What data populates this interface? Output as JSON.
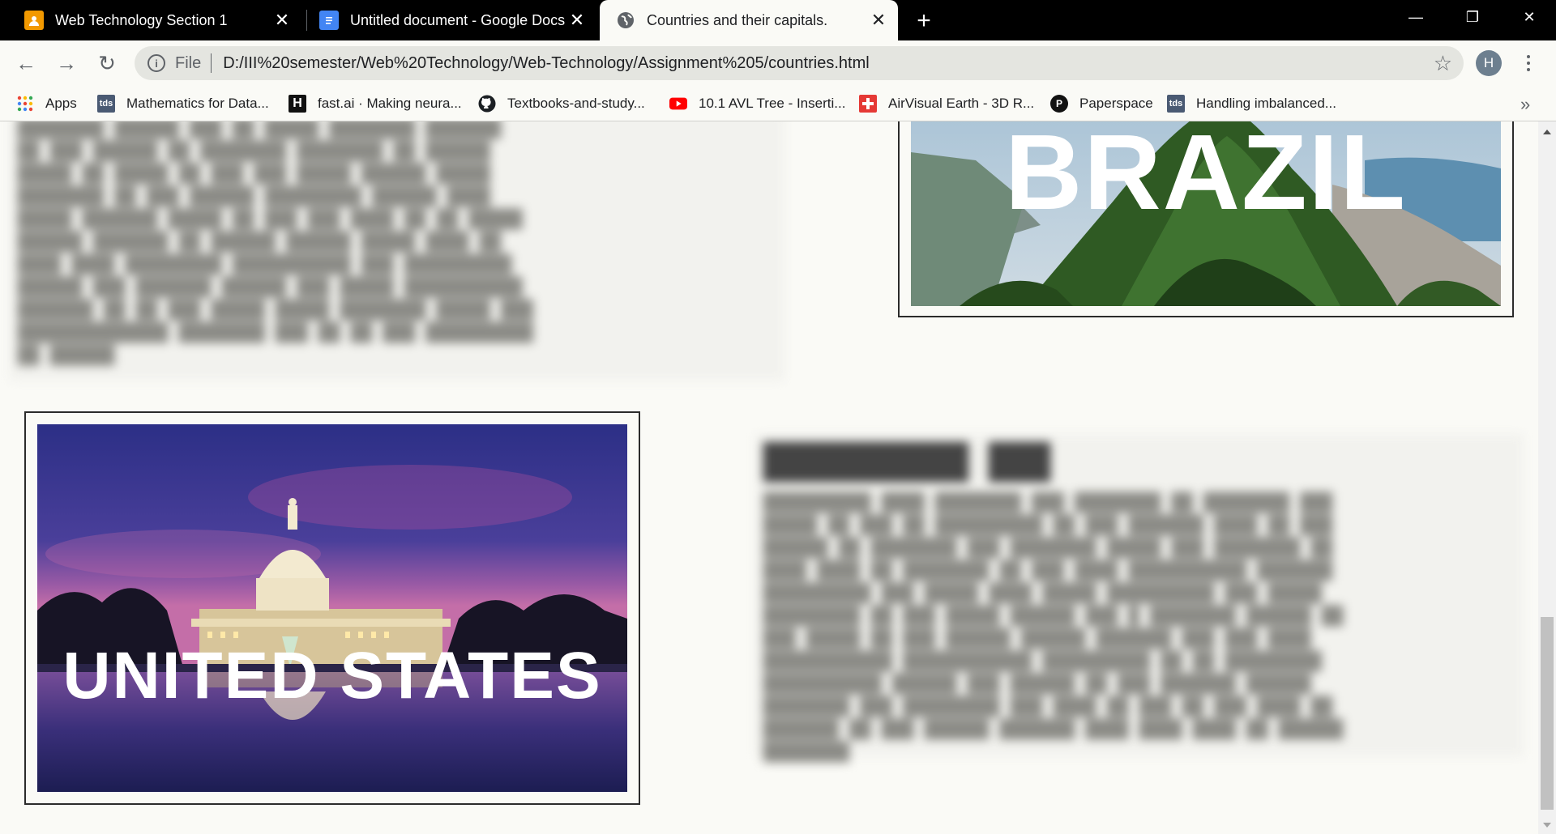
{
  "tabs": [
    {
      "title": "Web Technology Section 1",
      "close": "✕"
    },
    {
      "title": "Untitled document - Google Docs",
      "close": "✕"
    },
    {
      "title": "Countries and their capitals.",
      "close": "✕"
    }
  ],
  "new_tab": "+",
  "window_controls": {
    "minimize": "—",
    "restore": "❐",
    "close": "✕"
  },
  "toolbar": {
    "back": "←",
    "forward": "→",
    "reload": "↻",
    "scheme_label": "File",
    "url": "D:/III%20semester/Web%20Technology/Web-Technology/Assignment%205/countries.html",
    "bookmark_star": "☆",
    "profile_initial": "H"
  },
  "bookmarks": [
    {
      "label": "Apps"
    },
    {
      "label": "Mathematics for Data...",
      "icon_text": "tds"
    },
    {
      "label": "fast.ai · Making neura...",
      "icon_text": "H"
    },
    {
      "label": "Textbooks-and-study..."
    },
    {
      "label": "10.1 AVL Tree - Inserti..."
    },
    {
      "label": "AirVisual Earth - 3D R..."
    },
    {
      "label": "Paperspace",
      "icon_text": "P"
    },
    {
      "label": "Handling imbalanced...",
      "icon_text": "tds"
    }
  ],
  "bookmarks_more": "»",
  "content": {
    "brazil_image_label": "BRAZIL",
    "usa_image_label": "UNITED STATES"
  },
  "colors": {
    "page_background": "#fafaf6",
    "tabstrip_background": "#000000",
    "omnibox_background": "#e4e5e0"
  }
}
